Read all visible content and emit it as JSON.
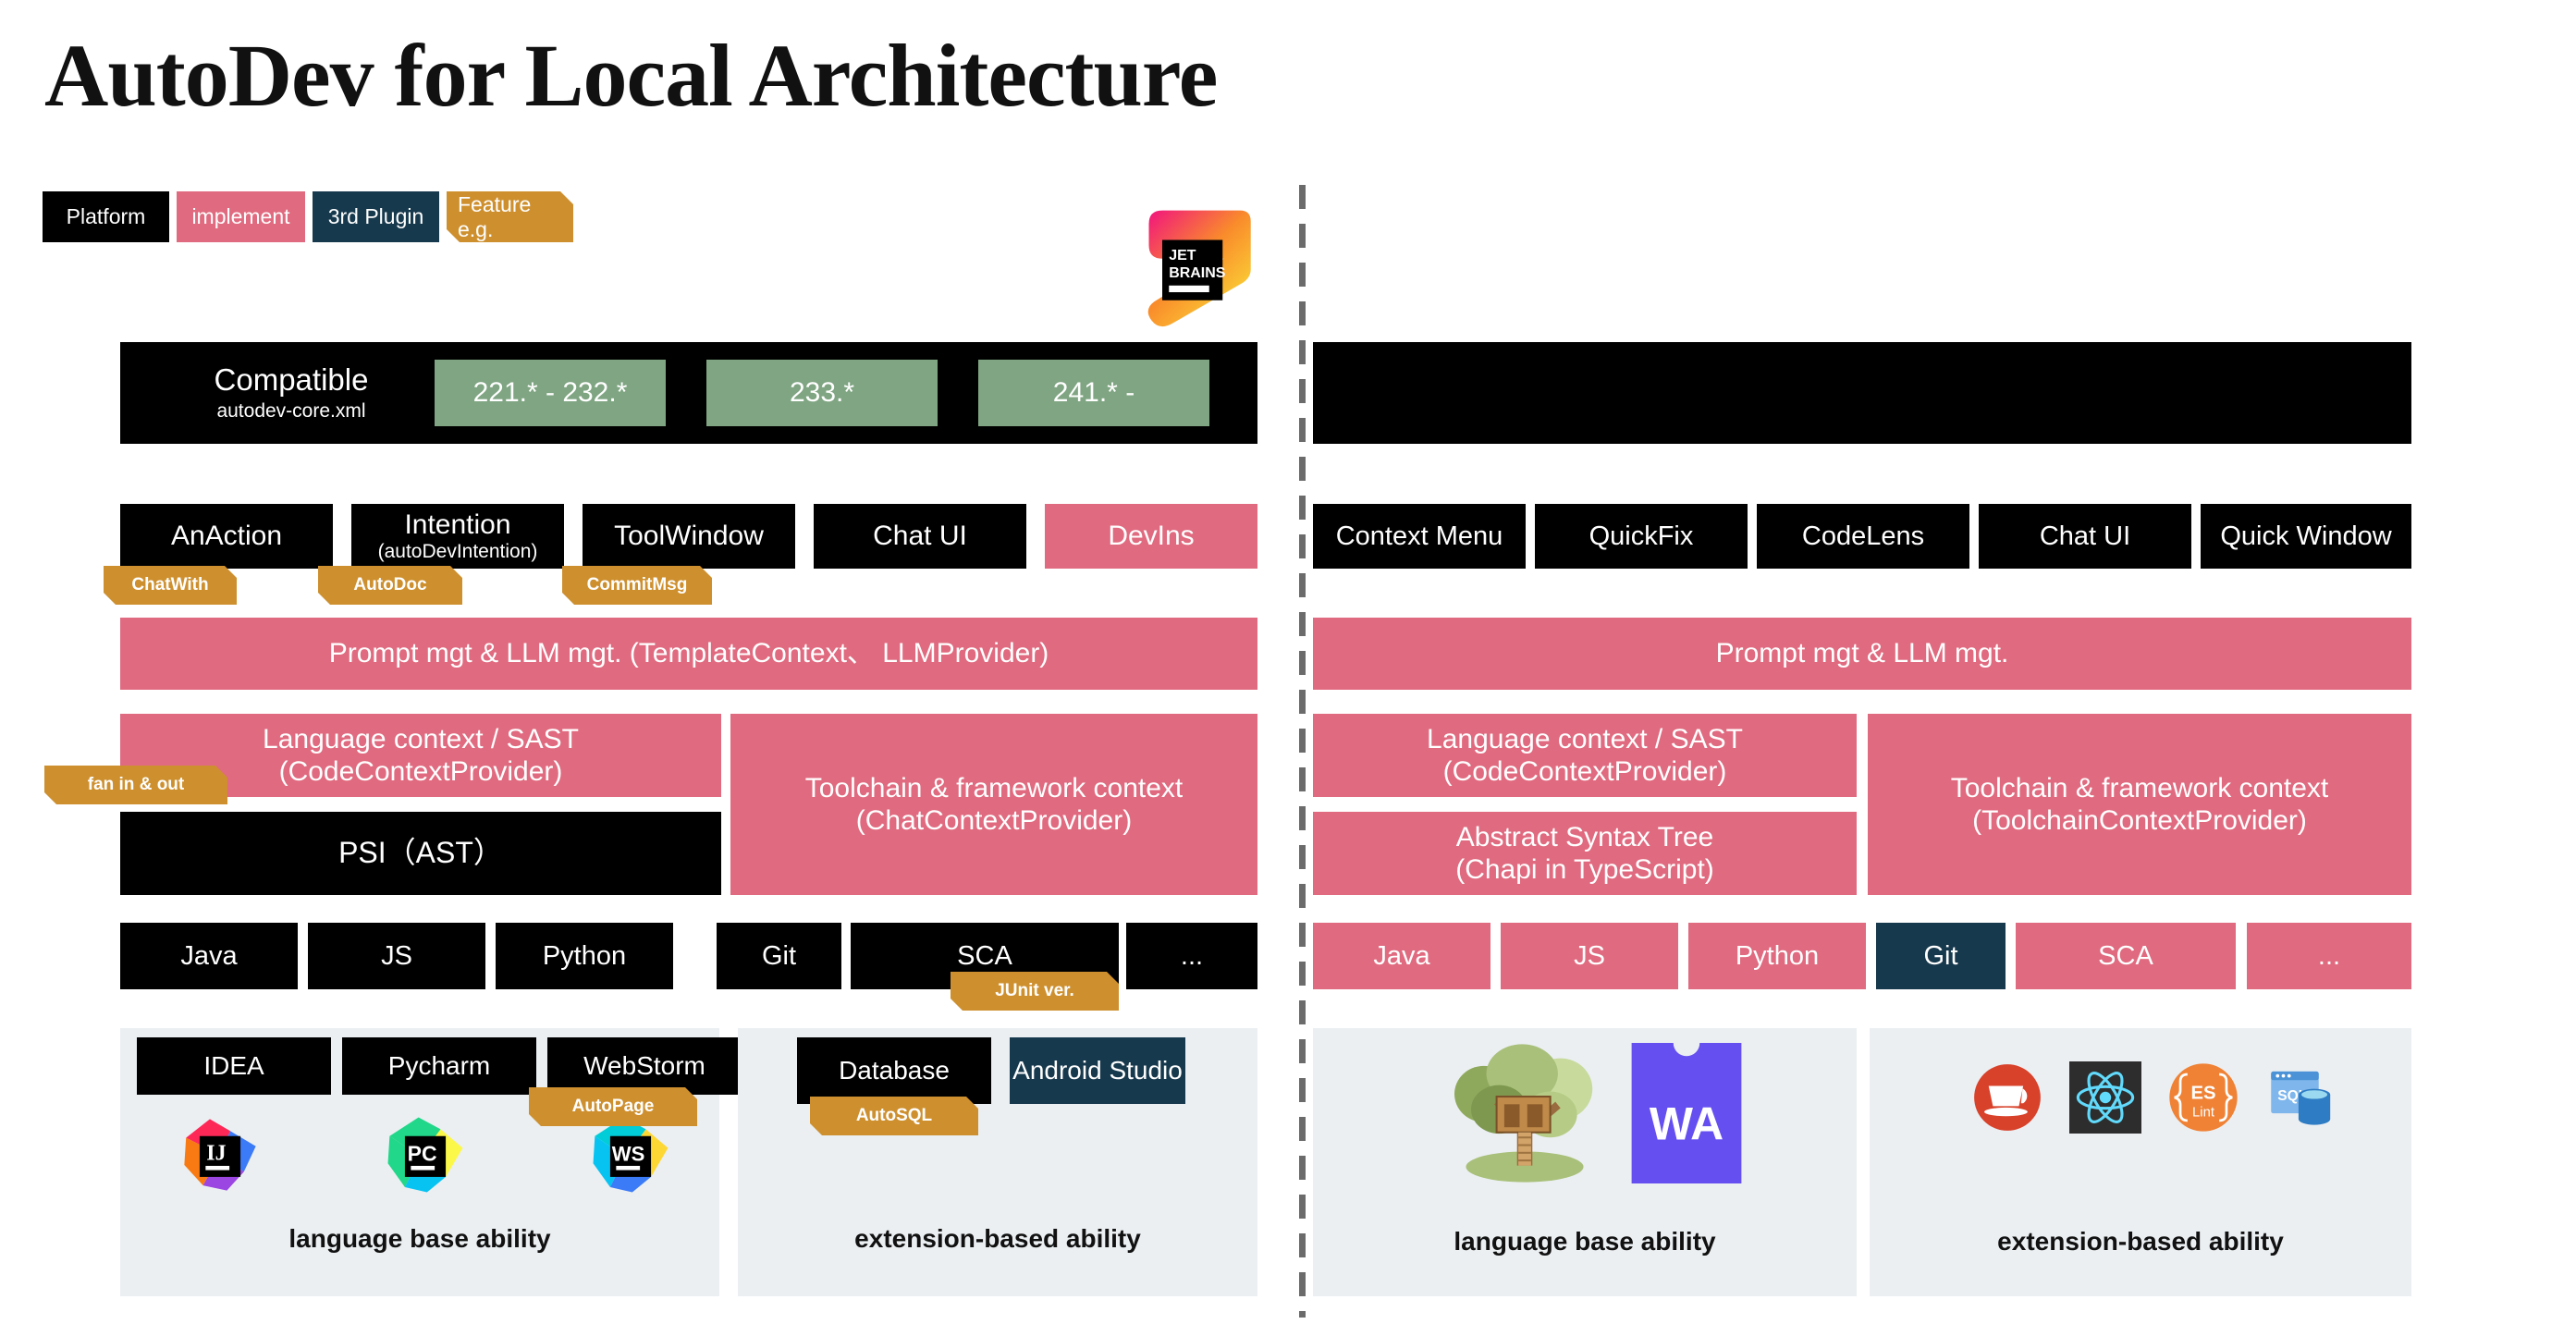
{
  "title": "AutoDev for Local Architecture",
  "legend": [
    {
      "label": "Platform",
      "color": "#000000",
      "kind": "platform"
    },
    {
      "label": "implement",
      "color": "#E06A7F",
      "kind": "implement"
    },
    {
      "label": "3rd Plugin",
      "color": "#17394D",
      "kind": "plugin"
    },
    {
      "label": "Feature e.g.",
      "color": "#CE902F",
      "kind": "feature"
    }
  ],
  "colors": {
    "black": "#000000",
    "pink": "#E06A7F",
    "teal": "#17394D",
    "gold": "#CE902F",
    "green": "#7FA582",
    "panel_bg": "#EBEFF2",
    "divider": "#6B6B6B"
  },
  "jetbrains": {
    "logo_text_line1": "JET",
    "logo_text_line2": "BRAINS",
    "compatible": {
      "title": "Compatible",
      "subtitle": "autodev-core.xml",
      "versions": [
        "221.* - 232.*",
        "233.*",
        "241.* -"
      ]
    },
    "entrypoints": [
      {
        "label": "AnAction",
        "sub": "",
        "color": "#000000"
      },
      {
        "label": "Intention",
        "sub": "(autoDevIntention)",
        "color": "#000000"
      },
      {
        "label": "ToolWindow",
        "sub": "",
        "color": "#000000"
      },
      {
        "label": "Chat UI",
        "sub": "",
        "color": "#000000"
      },
      {
        "label": "DevIns",
        "sub": "",
        "color": "#E06A7F"
      }
    ],
    "entrypoint_tags": [
      "ChatWith",
      "AutoDoc",
      "CommitMsg"
    ],
    "prompt_layer": "Prompt mgt &  LLM mgt. (TemplateContext、 LLMProvider)",
    "code_context": {
      "line1": "Language context / SAST",
      "line2": "(CodeContextProvider)"
    },
    "fan_tag": "fan in & out",
    "psi": "PSI（AST）",
    "toolchain_context": {
      "line1": "Toolchain & framework context",
      "line2": "(ChatContextProvider)"
    },
    "languages": [
      "Java",
      "JS",
      "Python",
      "Git",
      "SCA",
      "..."
    ],
    "language_tag": "JUnit ver.",
    "base_group": {
      "caption": "language base ability",
      "items": [
        "IDEA",
        "Pycharm",
        "WebStorm"
      ],
      "tag": "AutoPage",
      "icons": [
        "intellij-idea-icon",
        "pycharm-icon",
        "webstorm-icon"
      ]
    },
    "ext_group": {
      "caption": "extension-based ability",
      "items": [
        {
          "label": "Database",
          "color": "#000000"
        },
        {
          "label": "Android Studio",
          "color": "#17394D"
        }
      ],
      "tag": "AutoSQL"
    }
  },
  "vscode": {
    "header": "",
    "entrypoints": [
      {
        "label": "Context Menu"
      },
      {
        "label": "QuickFix"
      },
      {
        "label": "CodeLens"
      },
      {
        "label": "Chat UI"
      },
      {
        "label": "Quick Window"
      }
    ],
    "prompt_layer": "Prompt mgt &  LLM mgt.",
    "code_context": {
      "line1": "Language context / SAST",
      "line2": "(CodeContextProvider)"
    },
    "ast": {
      "line1": "Abstract Syntax Tree",
      "line2": "(Chapi in TypeScript)"
    },
    "toolchain_context": {
      "line1": "Toolchain & framework context",
      "line2": "(ToolchainContextProvider)"
    },
    "languages": [
      {
        "label": "Java",
        "color": "#E06A7F"
      },
      {
        "label": "JS",
        "color": "#E06A7F"
      },
      {
        "label": "Python",
        "color": "#E06A7F"
      },
      {
        "label": "Git",
        "color": "#17394D"
      },
      {
        "label": "SCA",
        "color": "#E06A7F"
      },
      {
        "label": "...",
        "color": "#E06A7F"
      }
    ],
    "base_group": {
      "caption": "language base ability",
      "icons": [
        "tree-sitter-icon",
        "webassembly-icon"
      ],
      "wasm_text": "WA"
    },
    "ext_group": {
      "caption": "extension-based ability",
      "icons": [
        "java-coffee-icon",
        "react-icon",
        "eslint-icon",
        "sql-database-icon"
      ],
      "eslint_text_top": "ES",
      "eslint_text_bottom": "Lint",
      "sql_text": "SQL"
    }
  }
}
